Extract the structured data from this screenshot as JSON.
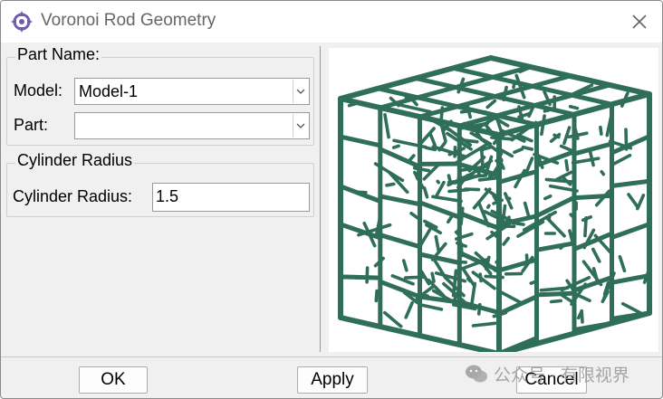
{
  "window": {
    "title": "Voronoi Rod Geometry"
  },
  "part_group": {
    "legend": "Part Name:",
    "model_label": "Model:",
    "model_value": "Model-1",
    "part_label": "Part:",
    "part_value": ""
  },
  "radius_group": {
    "legend": "Cylinder Radius",
    "radius_label": "Cylinder Radius:",
    "radius_value": "1.5"
  },
  "buttons": {
    "ok": "OK",
    "apply": "Apply",
    "cancel": "Cancel"
  },
  "watermark": {
    "text": "公众号 · 有限视界"
  },
  "icons": {
    "app": "abaqus-plugin-icon",
    "close": "close-icon",
    "preview": "voronoi-lattice-cube"
  },
  "colors": {
    "lattice": "#2f6e58",
    "lattice_edge": "#1f4d3d"
  }
}
